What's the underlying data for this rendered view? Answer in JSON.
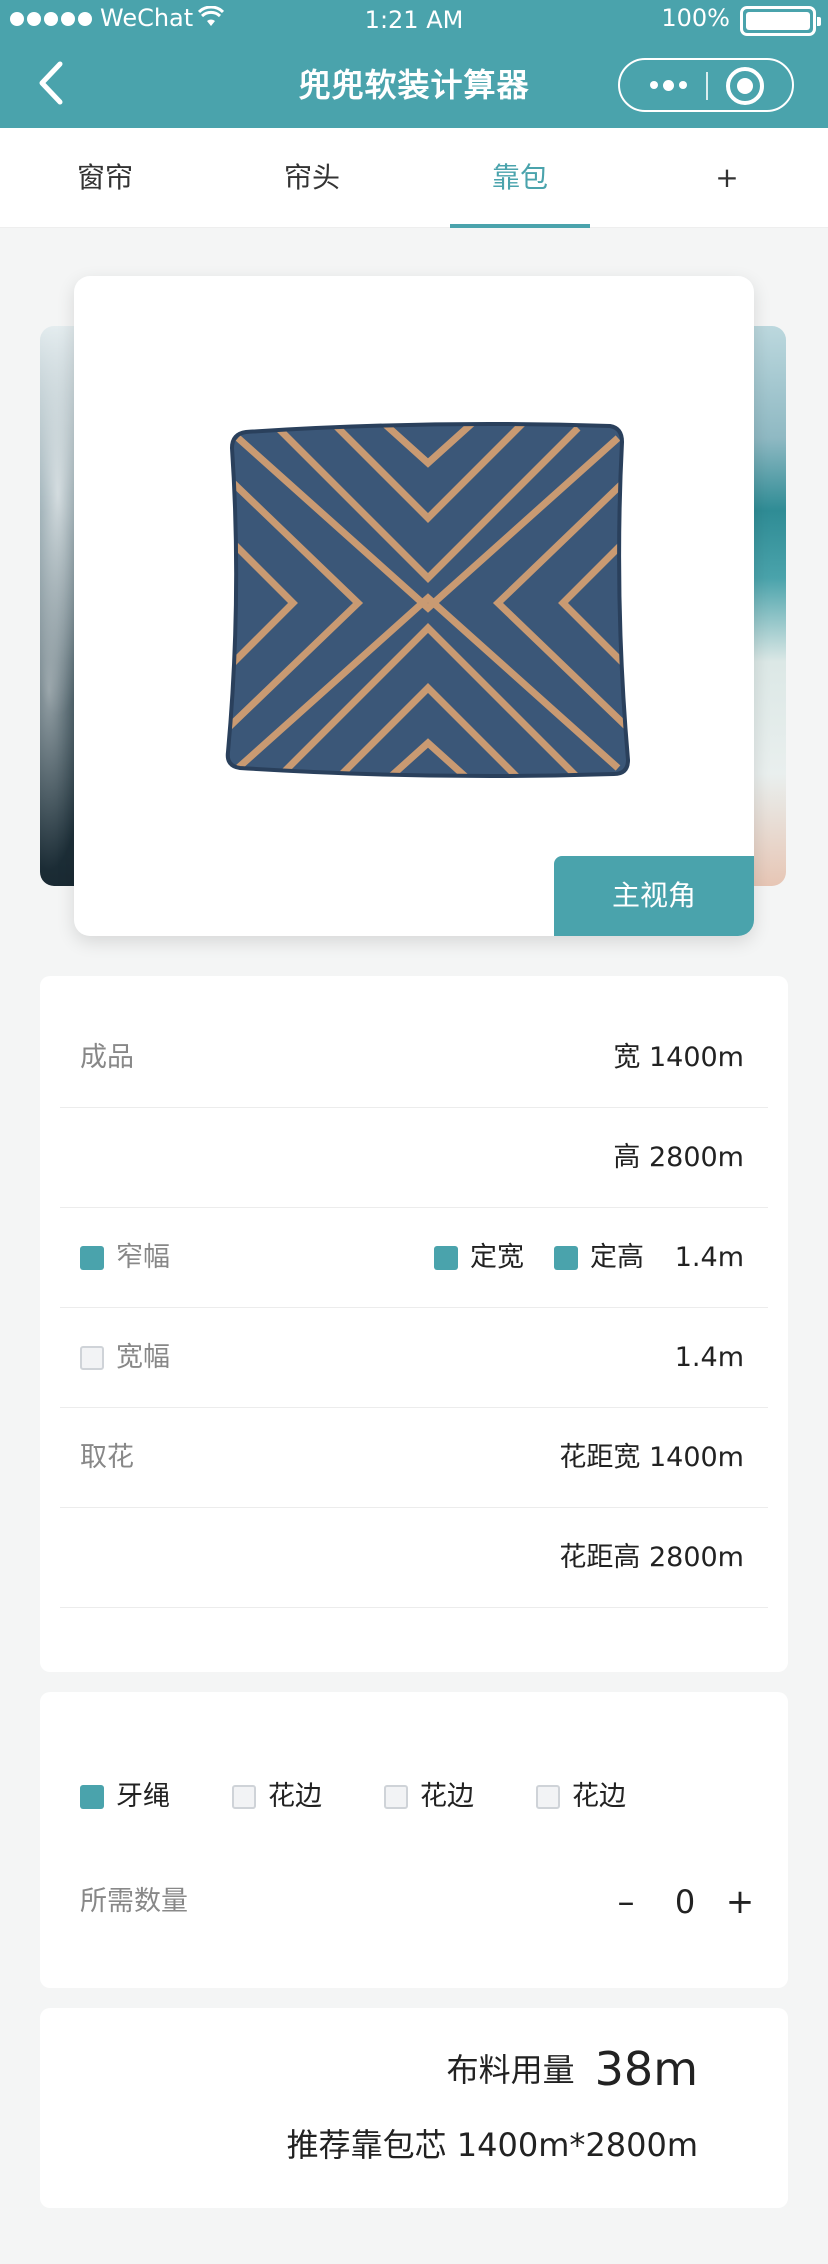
{
  "status": {
    "carrier": "WeChat",
    "time": "1:21 AM",
    "battery": "100%"
  },
  "nav": {
    "title": "兜兜软装计算器"
  },
  "tabs": [
    {
      "label": "窗帘",
      "active": false
    },
    {
      "label": "帘头",
      "active": false
    },
    {
      "label": "靠包",
      "active": true
    },
    {
      "label": "+",
      "active": false
    }
  ],
  "carousel": {
    "view_button": "主视角"
  },
  "spec": {
    "finished_label": "成品",
    "width": "宽 1400m",
    "height": "高 2800m",
    "narrow_label": "窄幅",
    "fixed_width": "定宽",
    "fixed_height": "定高",
    "narrow_value": "1.4m",
    "wide_label": "宽幅",
    "wide_value": "1.4m",
    "pattern_label": "取花",
    "pattern_width": "花距宽 1400m",
    "pattern_height": "花距高 2800m"
  },
  "options": {
    "items": [
      {
        "label": "牙绳",
        "checked": true
      },
      {
        "label": "花边",
        "checked": false
      },
      {
        "label": "花边",
        "checked": false
      },
      {
        "label": "花边",
        "checked": false
      }
    ],
    "quantity_label": "所需数量",
    "minus": "–",
    "quantity": "0",
    "plus": "+"
  },
  "result": {
    "usage_label": "布料用量",
    "usage_value": "38m",
    "recommend": "推荐靠包芯 1400m*2800m"
  },
  "colors": {
    "accent": "#4aa3ac"
  }
}
